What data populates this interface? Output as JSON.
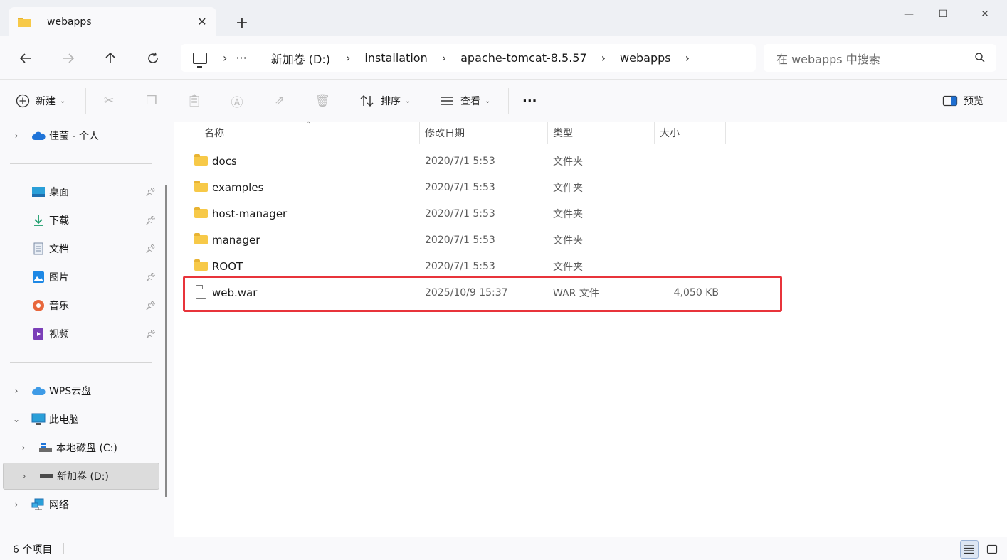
{
  "window": {
    "tab_title": "webapps",
    "minimize_glyph": "—",
    "maximize_glyph": "☐",
    "close_glyph": "✕"
  },
  "nav": {
    "back_icon": "arrow-left-icon",
    "forward_icon": "arrow-right-icon",
    "up_icon": "arrow-up-icon",
    "refresh_icon": "refresh-icon"
  },
  "breadcrumb": {
    "more": "···",
    "items": [
      "新加卷 (D:)",
      "installation",
      "apache-tomcat-8.5.57",
      "webapps"
    ]
  },
  "search": {
    "placeholder": "在 webapps 中搜索"
  },
  "toolbar": {
    "new_label": "新建",
    "sort_label": "排序",
    "view_label": "查看",
    "more_label": "···",
    "preview_label": "预览"
  },
  "sidebar": {
    "onedrive_label": "佳莹 - 个人",
    "quick_access": [
      {
        "label": "桌面",
        "icon": "desktop-icon"
      },
      {
        "label": "下载",
        "icon": "download-icon"
      },
      {
        "label": "文档",
        "icon": "document-icon"
      },
      {
        "label": "图片",
        "icon": "pictures-icon"
      },
      {
        "label": "音乐",
        "icon": "music-icon"
      },
      {
        "label": "视频",
        "icon": "video-icon"
      }
    ],
    "wps_label": "WPS云盘",
    "this_pc_label": "此电脑",
    "drive_c_label": "本地磁盘 (C:)",
    "drive_d_label": "新加卷 (D:)",
    "network_label": "网络"
  },
  "columns": {
    "name": "名称",
    "modified": "修改日期",
    "type": "类型",
    "size": "大小"
  },
  "files": [
    {
      "name": "docs",
      "modified": "2020/7/1 5:53",
      "type": "文件夹",
      "size": "",
      "kind": "folder"
    },
    {
      "name": "examples",
      "modified": "2020/7/1 5:53",
      "type": "文件夹",
      "size": "",
      "kind": "folder"
    },
    {
      "name": "host-manager",
      "modified": "2020/7/1 5:53",
      "type": "文件夹",
      "size": "",
      "kind": "folder"
    },
    {
      "name": "manager",
      "modified": "2020/7/1 5:53",
      "type": "文件夹",
      "size": "",
      "kind": "folder"
    },
    {
      "name": "ROOT",
      "modified": "2020/7/1 5:53",
      "type": "文件夹",
      "size": "",
      "kind": "folder"
    },
    {
      "name": "web.war",
      "modified": "2025/10/9 15:37",
      "type": "WAR 文件",
      "size": "4,050 KB",
      "kind": "file"
    }
  ],
  "status": {
    "item_count": "6 个项目"
  },
  "colors": {
    "highlight_border": "#e8343b",
    "folder": "#f7c948",
    "selected_bg": "#dcdcdc"
  }
}
